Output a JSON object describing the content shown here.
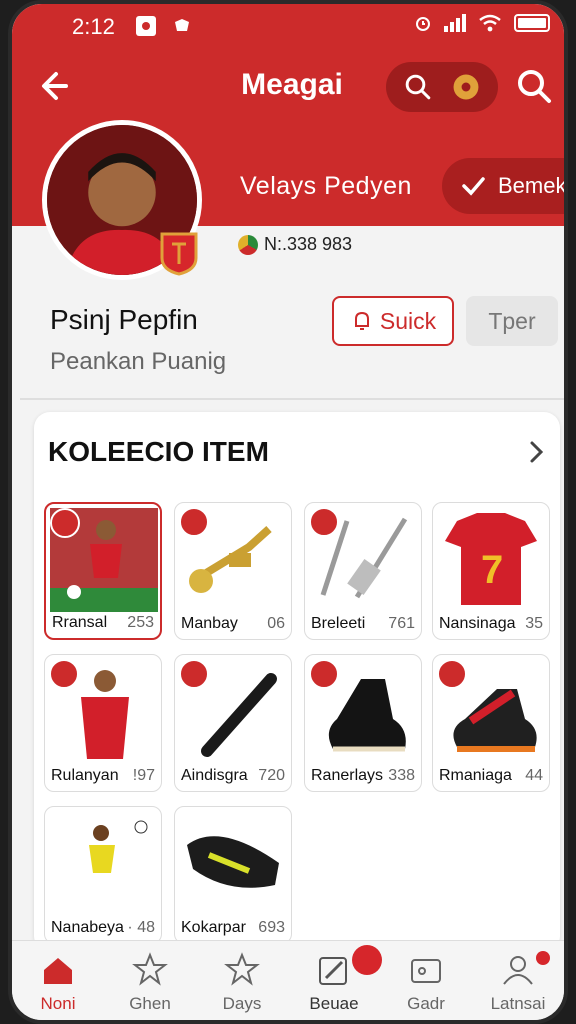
{
  "status_bar": {
    "time": "2:12"
  },
  "header": {
    "title": "Meagai",
    "tagline": "Velays  Pedyen",
    "follow_label": "Bemeke",
    "member_id": "N:.338 983"
  },
  "profile": {
    "name": "Psinj Pepfin",
    "subtitle": "Peankan Puanig",
    "quick_label": "Suick",
    "secondary_label": "Tper"
  },
  "collection": {
    "title": "KOLEECIO ITEM",
    "items": [
      {
        "label": "Rransal",
        "count": "253"
      },
      {
        "label": "Manbay",
        "count": "06"
      },
      {
        "label": "Breleeti",
        "count": "761"
      },
      {
        "label": "Nansinaga",
        "count": "35"
      },
      {
        "label": "Rulanyan",
        "count": "!97"
      },
      {
        "label": "Aindisgra",
        "count": "720"
      },
      {
        "label": "Ranerlays",
        "count": "338"
      },
      {
        "label": "Rmaniaga",
        "count": "44"
      },
      {
        "label": "Nanabeya",
        "count": "· 48"
      },
      {
        "label": "Kokarpar",
        "count": "693"
      }
    ]
  },
  "bottom_nav": [
    {
      "label": "Noni",
      "icon": "home-icon",
      "active": true
    },
    {
      "label": "Ghen",
      "icon": "star-icon"
    },
    {
      "label": "Days",
      "icon": "star-icon"
    },
    {
      "label": "Beuae",
      "icon": "edit-icon"
    },
    {
      "label": "Gadr",
      "icon": "wallet-icon"
    },
    {
      "label": "Latnsai",
      "icon": "user-icon"
    }
  ],
  "colors": {
    "accent": "#cc2b2b",
    "accent_dark": "#9e1d1d"
  }
}
